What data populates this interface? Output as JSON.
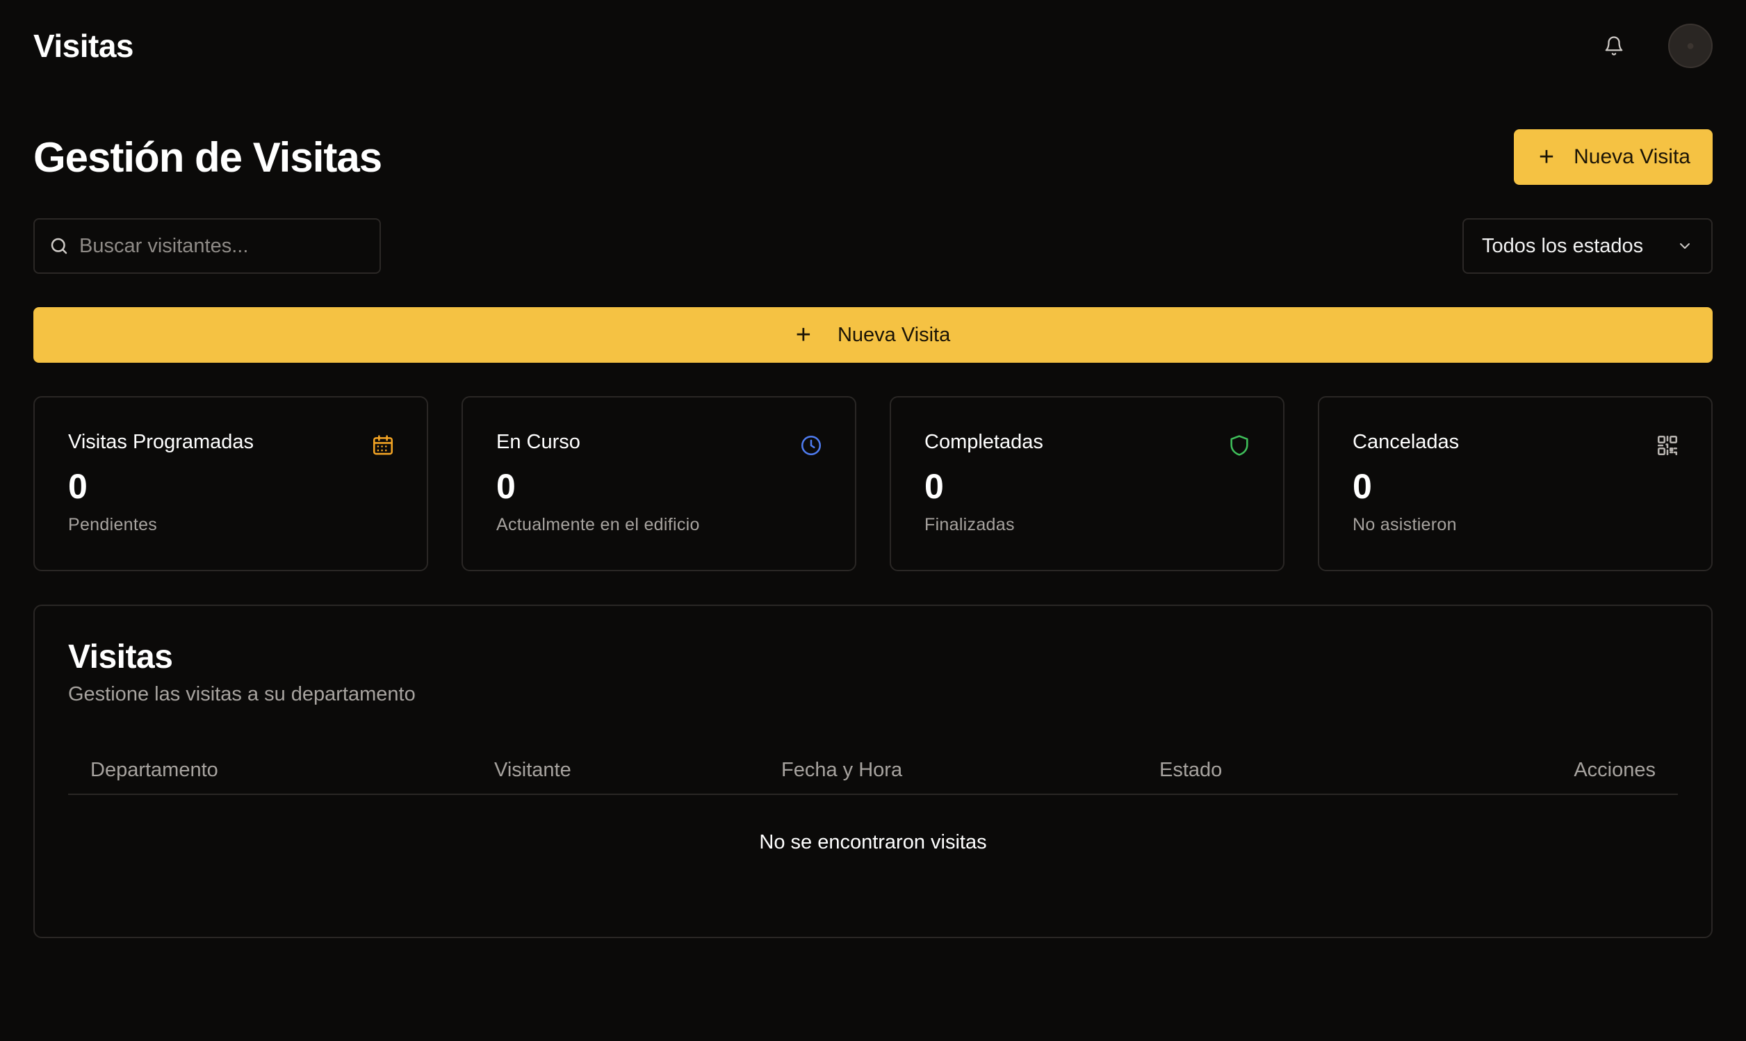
{
  "app": {
    "title": "Visitas"
  },
  "header": {
    "title": "Gestión de Visitas",
    "new_button_label": "Nueva Visita"
  },
  "search": {
    "placeholder": "Buscar visitantes...",
    "value": ""
  },
  "filter": {
    "selected": "Todos los estados"
  },
  "wide_button": {
    "label": "Nueva Visita"
  },
  "stats": [
    {
      "title": "Visitas Programadas",
      "value": "0",
      "subtitle": "Pendientes",
      "icon": "calendar-icon",
      "color": "#f5a524"
    },
    {
      "title": "En Curso",
      "value": "0",
      "subtitle": "Actualmente en el edificio",
      "icon": "clock-icon",
      "color": "#4f7cf0"
    },
    {
      "title": "Completadas",
      "value": "0",
      "subtitle": "Finalizadas",
      "icon": "shield-icon",
      "color": "#3fbf5a"
    },
    {
      "title": "Canceladas",
      "value": "0",
      "subtitle": "No asistieron",
      "icon": "qr-code-icon",
      "color": "#b8b4b0"
    }
  ],
  "table": {
    "title": "Visitas",
    "subtitle": "Gestione las visitas a su departamento",
    "columns": [
      "Departamento",
      "Visitante",
      "Fecha y Hora",
      "Estado",
      "Acciones"
    ],
    "empty_message": "No se encontraron visitas"
  },
  "colors": {
    "accent": "#f5c243",
    "background": "#0b0a09",
    "border": "#2a2725"
  }
}
